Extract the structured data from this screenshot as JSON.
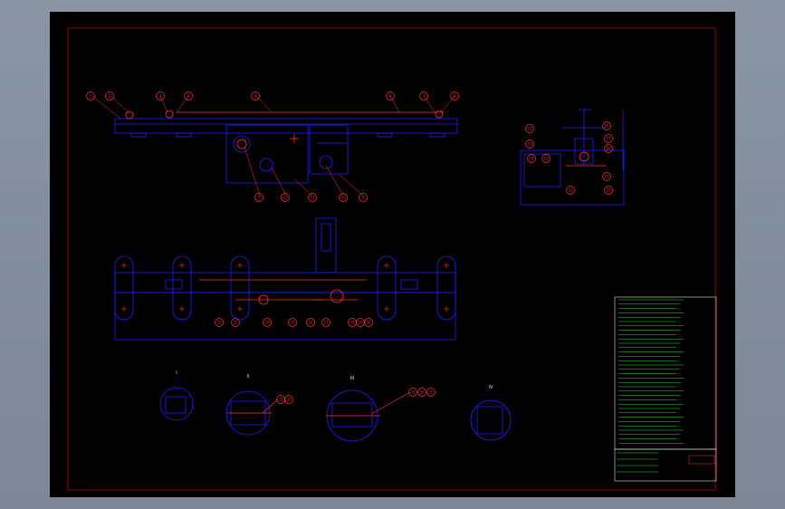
{
  "drawing": {
    "balloons_top": [
      "1",
      "2",
      "3",
      "4",
      "5",
      "6",
      "7",
      "8"
    ],
    "balloons_side_top": [
      "7",
      "12",
      "11",
      "10",
      "9"
    ],
    "balloons_small_view": [
      "11",
      "13",
      "14",
      "15",
      "16",
      "17",
      "18",
      "19",
      "20",
      "21"
    ],
    "balloons_plan": [
      "22",
      "23",
      "24",
      "25",
      "26",
      "27",
      "28",
      "29",
      "30"
    ],
    "balloons_sections": [
      "31",
      "32",
      "33",
      "34",
      "35"
    ],
    "section_labels": [
      "I",
      "II",
      "III",
      "IV"
    ],
    "title_block": {
      "drawing_title": "—"
    }
  }
}
